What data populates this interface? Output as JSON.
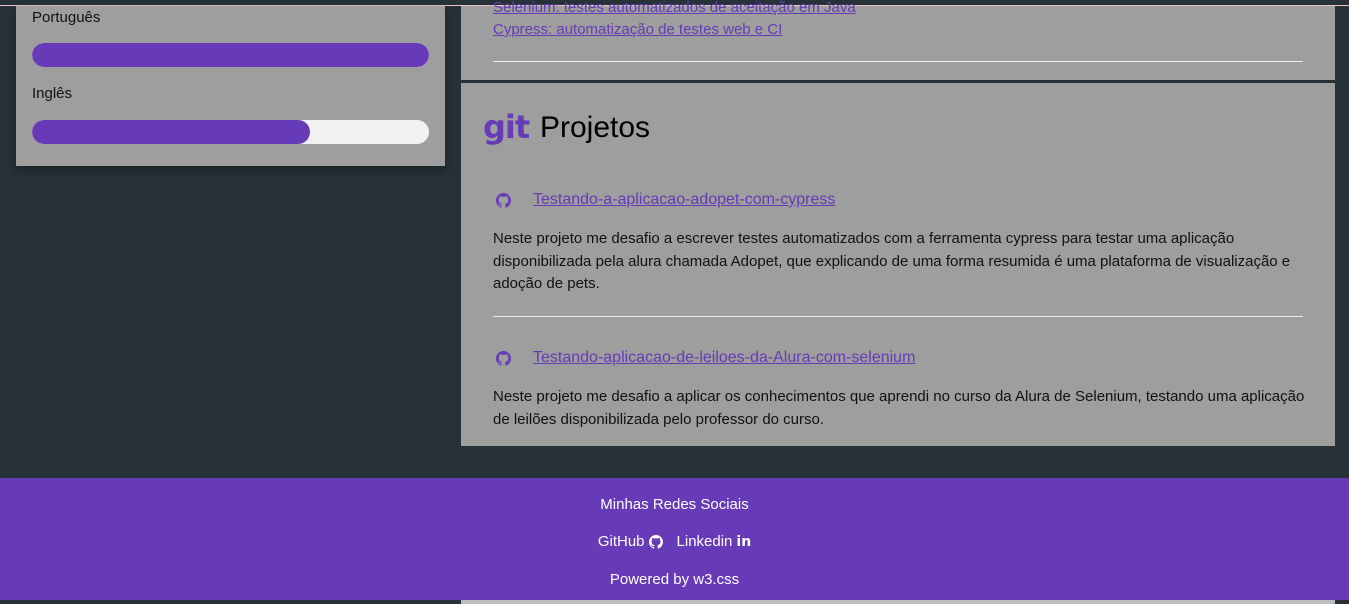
{
  "languages": [
    {
      "label": "Português",
      "level": 1.0
    },
    {
      "label": "Inglês",
      "level": 0.7
    }
  ],
  "courses": {
    "items": [
      "Selenium: testes automatizados de aceitação em Java",
      "Cypress: automatização de testes web e CI"
    ]
  },
  "projects": {
    "title": "Projetos",
    "logo_text": "git",
    "items": [
      {
        "name": "Testando-a-aplicacao-adopet-com-cypress",
        "description": "Neste projeto me desafio a escrever testes automatizados com a ferramenta cypress para testar uma aplicação disponibilizada pela alura chamada Adopet, que explicando de uma forma resumida é uma plataforma de visualização e adoção de pets."
      },
      {
        "name": "Testando-aplicacao-de-leiloes-da-Alura-com-selenium",
        "description": "Neste projeto me desafio a aplicar os conhecimentos que aprendi no curso da Alura de Selenium, testando uma aplicação de leilões disponibilizada pelo professor do curso."
      }
    ]
  },
  "footer": {
    "title": "Minhas Redes Sociais",
    "github_label": "GitHub",
    "linkedin_label": "Linkedin",
    "linkedin_icon_text": "in",
    "powered": "Powered by w3.css"
  },
  "colors": {
    "accent": "#673ab7",
    "card": "#9e9e9e",
    "background": "#263238"
  }
}
